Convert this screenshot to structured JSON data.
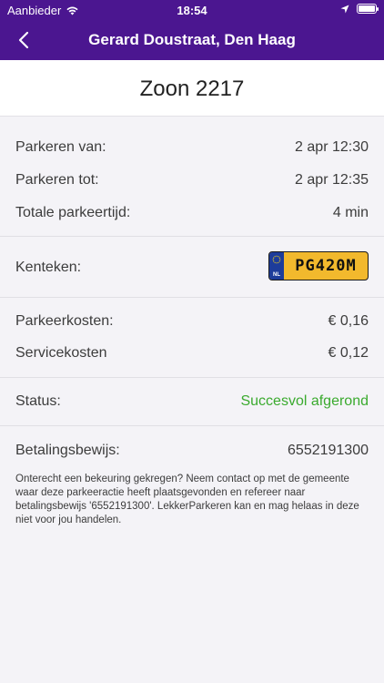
{
  "status_bar": {
    "carrier": "Aanbieder",
    "time": "18:54",
    "icons": [
      "wifi-icon",
      "location-arrow-icon",
      "battery-icon"
    ]
  },
  "nav": {
    "title": "Gerard Doustraat, Den Haag",
    "back_icon": "chevron-left-icon"
  },
  "zone": {
    "title": "Zoon 2217"
  },
  "times": {
    "start_label": "Parkeren van:",
    "start_value": "2 apr 12:30",
    "end_label": "Parkeren tot:",
    "end_value": "2 apr 12:35",
    "total_label": "Totale parkeertijd:",
    "total_value": "4 min"
  },
  "plate": {
    "label": "Kenteken:",
    "number": "PG420M",
    "country": "NL"
  },
  "costs": {
    "parking_label": "Parkeerkosten:",
    "parking_value": "€ 0,16",
    "service_label": "Servicekosten",
    "service_value": "€ 0,12"
  },
  "status": {
    "label": "Status:",
    "value": "Succesvol afgerond"
  },
  "receipt": {
    "label": "Betalingsbewijs:",
    "value": "6552191300"
  },
  "note": "Onterecht een bekeuring gekregen? Neem contact op met de gemeente waar deze parkeeractie heeft plaatsgevonden en refereer naar betalingsbewijs '6552191300'. LekkerParkeren kan en mag helaas in deze niet voor jou handelen.",
  "colors": {
    "header": "#4b1690",
    "success": "#3aaa2e",
    "plate_yellow": "#f2b92d",
    "plate_blue": "#1d3c9a"
  }
}
